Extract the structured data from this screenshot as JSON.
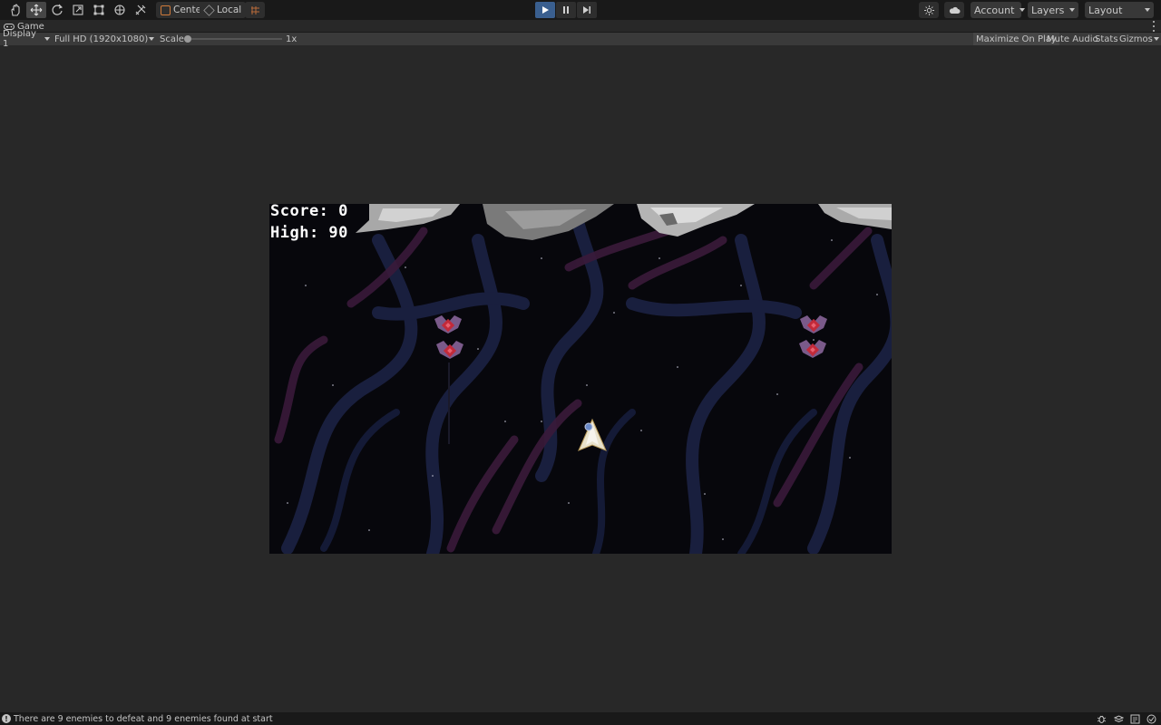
{
  "toolbar": {
    "tools": [
      "hand-tool",
      "move-tool",
      "rotate-tool",
      "scale-tool",
      "rect-tool",
      "transform-tool",
      "custom-tool"
    ],
    "pivot_label": "Center",
    "space_label": "Local",
    "account_label": "Account",
    "layers_label": "Layers",
    "layout_label": "Layout",
    "play_color": "#3a5f8f"
  },
  "tab": {
    "label": "Game"
  },
  "gamebar": {
    "display": "Display 1",
    "resolution": "Full HD (1920x1080)",
    "scale_label": "Scale",
    "scale_value": "1x",
    "maximize_label": "Maximize On Play",
    "mute_label": "Mute Audio",
    "stats_label": "Stats",
    "gizmos_label": "Gizmos"
  },
  "game": {
    "score_text": "Score: 0",
    "high_text": "High: 90"
  },
  "status": {
    "message": "There are 9 enemies to defeat and 9 enemies found at start"
  }
}
